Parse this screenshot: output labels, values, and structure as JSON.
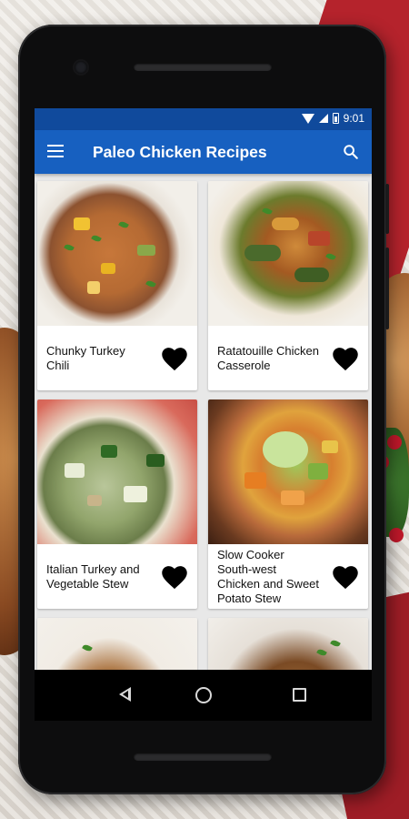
{
  "status_bar": {
    "time": "9:01",
    "icons": [
      "wifi-icon",
      "signal-icon",
      "battery-icon"
    ]
  },
  "app_bar": {
    "title": "Paleo Chicken Recipes",
    "menu_icon": "menu-icon",
    "search_icon": "search-icon"
  },
  "recipes": [
    {
      "title": "Chunky Turkey Chili",
      "favorite_icon": "heart-icon"
    },
    {
      "title": "Ratatouille Chicken Casserole",
      "favorite_icon": "heart-icon"
    },
    {
      "title": "Italian Turkey and Vegetable Stew",
      "favorite_icon": "heart-icon"
    },
    {
      "title": "Slow Cooker South-west Chicken and Sweet Potato Stew",
      "favorite_icon": "heart-icon"
    },
    {
      "title": "",
      "favorite_icon": ""
    },
    {
      "title": "",
      "favorite_icon": ""
    }
  ],
  "nav_bar": {
    "buttons": [
      "back-icon",
      "home-icon",
      "recents-icon"
    ]
  },
  "colors": {
    "status_bar": "#104a9c",
    "app_bar": "#1760c0",
    "list_background": "#e8e8e8",
    "card_background": "#ffffff",
    "heart": "#000000"
  }
}
